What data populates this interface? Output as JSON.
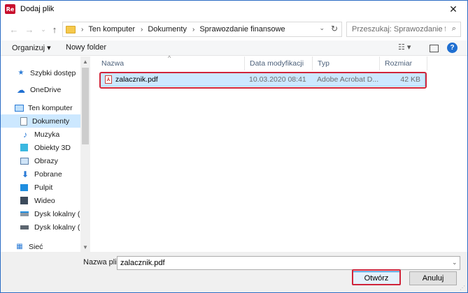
{
  "window": {
    "title": "Dodaj plik",
    "app_icon_text": "Re",
    "close_glyph": "✕"
  },
  "address": {
    "crumbs": [
      "Ten komputer",
      "Dokumenty",
      "Sprawozdanie finansowe"
    ],
    "search_placeholder": "Przeszukaj: Sprawozdanie fina..."
  },
  "toolbar": {
    "organize_label": "Organizuj ▾",
    "new_folder_label": "Nowy folder",
    "help_glyph": "?"
  },
  "sidebar": {
    "items": [
      {
        "label": "Szybki dostęp",
        "icon": "star-icon"
      },
      {
        "label": "OneDrive",
        "icon": "cloud-icon"
      },
      {
        "label": "Ten komputer",
        "icon": "computer-icon"
      },
      {
        "label": "Dokumenty",
        "icon": "document-icon"
      },
      {
        "label": "Muzyka",
        "icon": "music-icon"
      },
      {
        "label": "Obiekty 3D",
        "icon": "cube-icon"
      },
      {
        "label": "Obrazy",
        "icon": "image-icon"
      },
      {
        "label": "Pobrane",
        "icon": "download-icon"
      },
      {
        "label": "Pulpit",
        "icon": "desktop-icon"
      },
      {
        "label": "Wideo",
        "icon": "video-icon"
      },
      {
        "label": "Dysk lokalny (C:)",
        "icon": "drive-icon"
      },
      {
        "label": "Dysk lokalny (D:)",
        "icon": "drive-icon"
      },
      {
        "label": "Sieć",
        "icon": "network-icon"
      }
    ]
  },
  "filelist": {
    "columns": [
      "Nazwa",
      "Data modyfikacji",
      "Typ",
      "Rozmiar"
    ],
    "rows": [
      {
        "name": "zalacznik.pdf",
        "modified": "10.03.2020 08:41",
        "type": "Adobe Acrobat D...",
        "size": "42 KB"
      }
    ]
  },
  "bottom": {
    "filename_label": "Nazwa pliku:",
    "filename_value": "zalacznik.pdf",
    "open_label": "Otwórz",
    "cancel_label": "Anuluj"
  },
  "colors": {
    "accent": "#0078d7",
    "selection": "#cce8ff",
    "highlight": "#d0243a",
    "app_icon": "#c8102e"
  }
}
